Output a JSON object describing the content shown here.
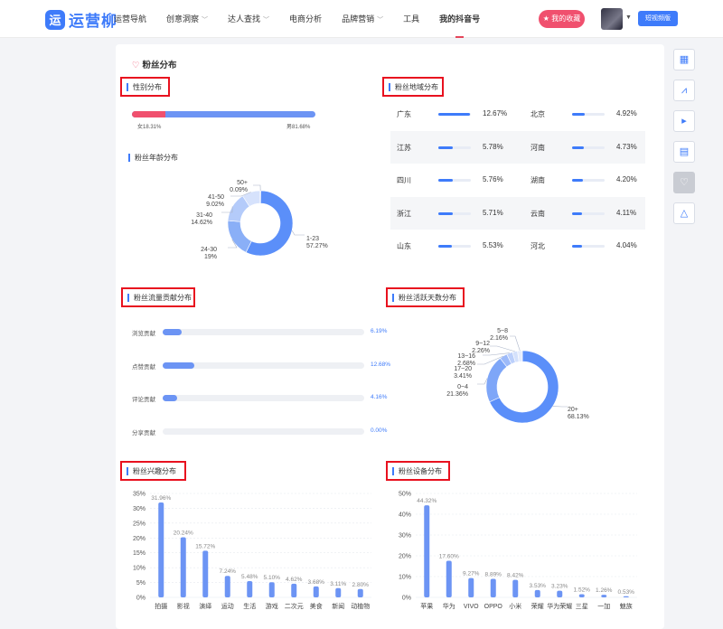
{
  "header": {
    "logo_mark": "运",
    "logo_text": "运营柳",
    "nav": [
      {
        "label": "运营导航",
        "dropdown": false
      },
      {
        "label": "创意洞察",
        "dropdown": true
      },
      {
        "label": "达人查找",
        "dropdown": true
      },
      {
        "label": "电商分析",
        "dropdown": false
      },
      {
        "label": "品牌营销",
        "dropdown": true
      },
      {
        "label": "工具",
        "dropdown": false
      },
      {
        "label": "我的抖音号",
        "dropdown": false,
        "active": true
      }
    ],
    "favorites_label": "★ 我的收藏",
    "video_tag": "短视频版"
  },
  "right_tools": [
    "grid-icon",
    "chart-icon",
    "play-icon",
    "document-icon",
    "heart-icon",
    "up-arrow-icon"
  ],
  "colors": {
    "accent": "#3e7bfa",
    "female": "#f0506e",
    "male": "#6c94f4",
    "highlight_box": "#e8111f"
  },
  "fans": {
    "title": "粉丝分布",
    "gender": {
      "title": "性别分布",
      "female_label": "女18.31%",
      "male_label": "男81.68%",
      "female_pct": 18.31,
      "male_pct": 81.68
    },
    "age_title": "粉丝年龄分布",
    "region": {
      "title": "粉丝地域分布",
      "rows": [
        {
          "left": {
            "name": "广东",
            "value": "12.67%",
            "pct": 12.67
          },
          "right": {
            "name": "北京",
            "value": "4.92%",
            "pct": 4.92
          }
        },
        {
          "left": {
            "name": "江苏",
            "value": "5.78%",
            "pct": 5.78
          },
          "right": {
            "name": "河南",
            "value": "4.73%",
            "pct": 4.73
          }
        },
        {
          "left": {
            "name": "四川",
            "value": "5.76%",
            "pct": 5.76
          },
          "right": {
            "name": "湖南",
            "value": "4.20%",
            "pct": 4.2
          }
        },
        {
          "left": {
            "name": "浙江",
            "value": "5.71%",
            "pct": 5.71
          },
          "right": {
            "name": "云南",
            "value": "4.11%",
            "pct": 4.11
          }
        },
        {
          "left": {
            "name": "山东",
            "value": "5.53%",
            "pct": 5.53
          },
          "right": {
            "name": "河北",
            "value": "4.04%",
            "pct": 4.04
          }
        }
      ]
    },
    "contribution": {
      "title": "粉丝流量贡献分布",
      "rows": [
        {
          "label": "浏览贡献",
          "value": "6.19%",
          "pct": 6.19
        },
        {
          "label": "点赞贡献",
          "value": "12.68%",
          "pct": 12.68
        },
        {
          "label": "评论贡献",
          "value": "4.16%",
          "pct": 4.16
        },
        {
          "label": "分享贡献",
          "value": "0.00%",
          "pct": 0.0
        }
      ]
    },
    "active_days_title": "粉丝活跃天数分布",
    "interest_title": "粉丝兴趣分布",
    "device_title": "粉丝设备分布"
  },
  "chart_data": [
    {
      "type": "pie",
      "id": "age",
      "labels": [
        "1-23",
        "24-30",
        "31-40",
        "41-50",
        "50+"
      ],
      "values": [
        57.27,
        19,
        14.62,
        9.02,
        0.09
      ],
      "value_labels": [
        "57.27%",
        "19%",
        "14.62%",
        "9.02%",
        "0.09%"
      ],
      "colors": [
        "#5b8ff9",
        "#8aaff7",
        "#b4cbfa",
        "#d6e2fc",
        "#eaf0fd"
      ]
    },
    {
      "type": "pie",
      "id": "active_days",
      "labels": [
        "20+",
        "0~4",
        "17~20",
        "13~16",
        "9~12",
        "5~8"
      ],
      "values": [
        68.13,
        21.36,
        3.41,
        2.68,
        2.26,
        2.16
      ],
      "value_labels": [
        "68.13%",
        "21.36%",
        "3.41%",
        "2.68%",
        "2.26%",
        "2.16%"
      ],
      "colors": [
        "#5b8ff9",
        "#7ea6f8",
        "#9dbaf9",
        "#bcd0fb",
        "#d4e1fc",
        "#e6edfd"
      ]
    },
    {
      "type": "bar",
      "id": "interest",
      "categories": [
        "拍摄",
        "影视",
        "演绎",
        "运动",
        "生活",
        "游戏",
        "二次元",
        "美食",
        "新闻",
        "动植物"
      ],
      "values": [
        31.96,
        20.24,
        15.72,
        7.24,
        5.48,
        5.1,
        4.62,
        3.68,
        3.11,
        2.8
      ],
      "value_labels": [
        "31.96%",
        "20.24%",
        "15.72%",
        "7.24%",
        "5.48%",
        "5.10%",
        "4.62%",
        "3.68%",
        "3.11%",
        "2.80%"
      ],
      "yticks": [
        "0%",
        "5%",
        "10%",
        "15%",
        "20%",
        "25%",
        "30%",
        "35%"
      ],
      "ylim": [
        0,
        35
      ]
    },
    {
      "type": "bar",
      "id": "device",
      "categories": [
        "苹果",
        "华为",
        "VIVO",
        "OPPO",
        "小米",
        "荣耀",
        "华为荣耀",
        "三星",
        "一加",
        "魅族"
      ],
      "values": [
        44.32,
        17.6,
        9.27,
        8.89,
        8.42,
        3.53,
        3.23,
        1.52,
        1.26,
        0.53
      ],
      "value_labels": [
        "44.32%",
        "17.60%",
        "9.27%",
        "8.89%",
        "8.42%",
        "3.53%",
        "3.23%",
        "1.52%",
        "1.26%",
        "0.53%"
      ],
      "yticks": [
        "0%",
        "10%",
        "20%",
        "30%",
        "40%",
        "50%"
      ],
      "ylim": [
        0,
        50
      ]
    }
  ]
}
